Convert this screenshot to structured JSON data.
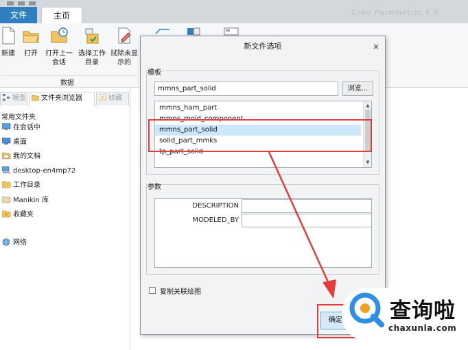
{
  "ribbon": {
    "tab_file": "文件",
    "tab_home": "主页",
    "title_faint": "Creo Parametric 6.0",
    "buttons": {
      "new": "新建",
      "open": "打开",
      "open_last_1": "打开上一",
      "open_last_2": "会话",
      "select_dir_1": "选择工作",
      "select_dir_2": "目录",
      "erase_1": "拭除未显",
      "erase_2": "示的"
    },
    "group_label": "数据"
  },
  "left_panel": {
    "tabs": [
      "模型",
      "文件夹浏览器",
      "收藏"
    ],
    "section_title": "常用文件夹",
    "items": [
      "在会话中",
      "桌面",
      "我的文档",
      "desktop-en4mp72",
      "工作目录",
      "Manikin 库",
      "收藏夹",
      "网络"
    ]
  },
  "dialog": {
    "title": "新文件选项",
    "close": "×",
    "template_group": "模板",
    "template_value": "mmns_part_solid",
    "browse": "浏览...",
    "templates": [
      "mmns_harn_part",
      "mmns_mold_component",
      "mmns_part_solid",
      "solid_part_mmks",
      "tp_part_solid"
    ],
    "selected_index": 2,
    "params_group": "参数",
    "params": [
      {
        "name": "DESCRIPTION",
        "value": ""
      },
      {
        "name": "MODELED_BY",
        "value": ""
      }
    ],
    "copy_drawing_label": "复制关联绘图",
    "ok": "确定"
  },
  "watermark": {
    "text": "查询啦",
    "url": "chaxunla.com"
  },
  "colors": {
    "file_tab": "#2f7fc1",
    "selection": "#cde8fb",
    "annotation_red": "#e23c3c"
  }
}
